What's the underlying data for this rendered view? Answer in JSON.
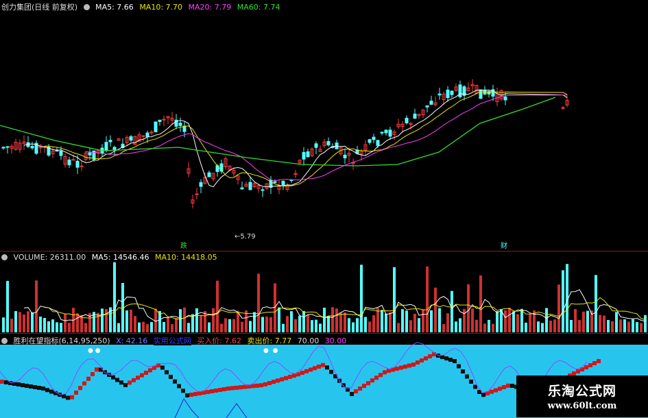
{
  "price": {
    "title": "创力集团(日线 前复权)",
    "ma5": "MA5: 7.66",
    "ma10": "MA10: 7.70",
    "ma20": "MA20: 7.79",
    "ma60": "MA60: 7.74",
    "low_label": "←5.79",
    "mark_die": "跌",
    "mark_cai": "财",
    "colors": {
      "up": "#ff3b3b",
      "down": "#54ffff",
      "ma5": "#ffffff",
      "ma10": "#e8e800",
      "ma20": "#ff40ff",
      "ma60": "#30e030"
    }
  },
  "volume": {
    "title": "VOLUME: 26311.00",
    "ma5": "MA5: 14546.46",
    "ma10": "MA10: 14418.05"
  },
  "indicator": {
    "title": "胜利在望指标(6,14,95,250)",
    "x_val": "X: 42.16",
    "tag": "实用公式网",
    "buy": "买入价: 7.62",
    "sell": "卖出价: 7.77",
    "v70": "70.00",
    "v30": "30.00",
    "bg": "#27c5ee"
  },
  "watermark": {
    "name": "乐淘公式网",
    "url": "www.60lt.com"
  }
}
